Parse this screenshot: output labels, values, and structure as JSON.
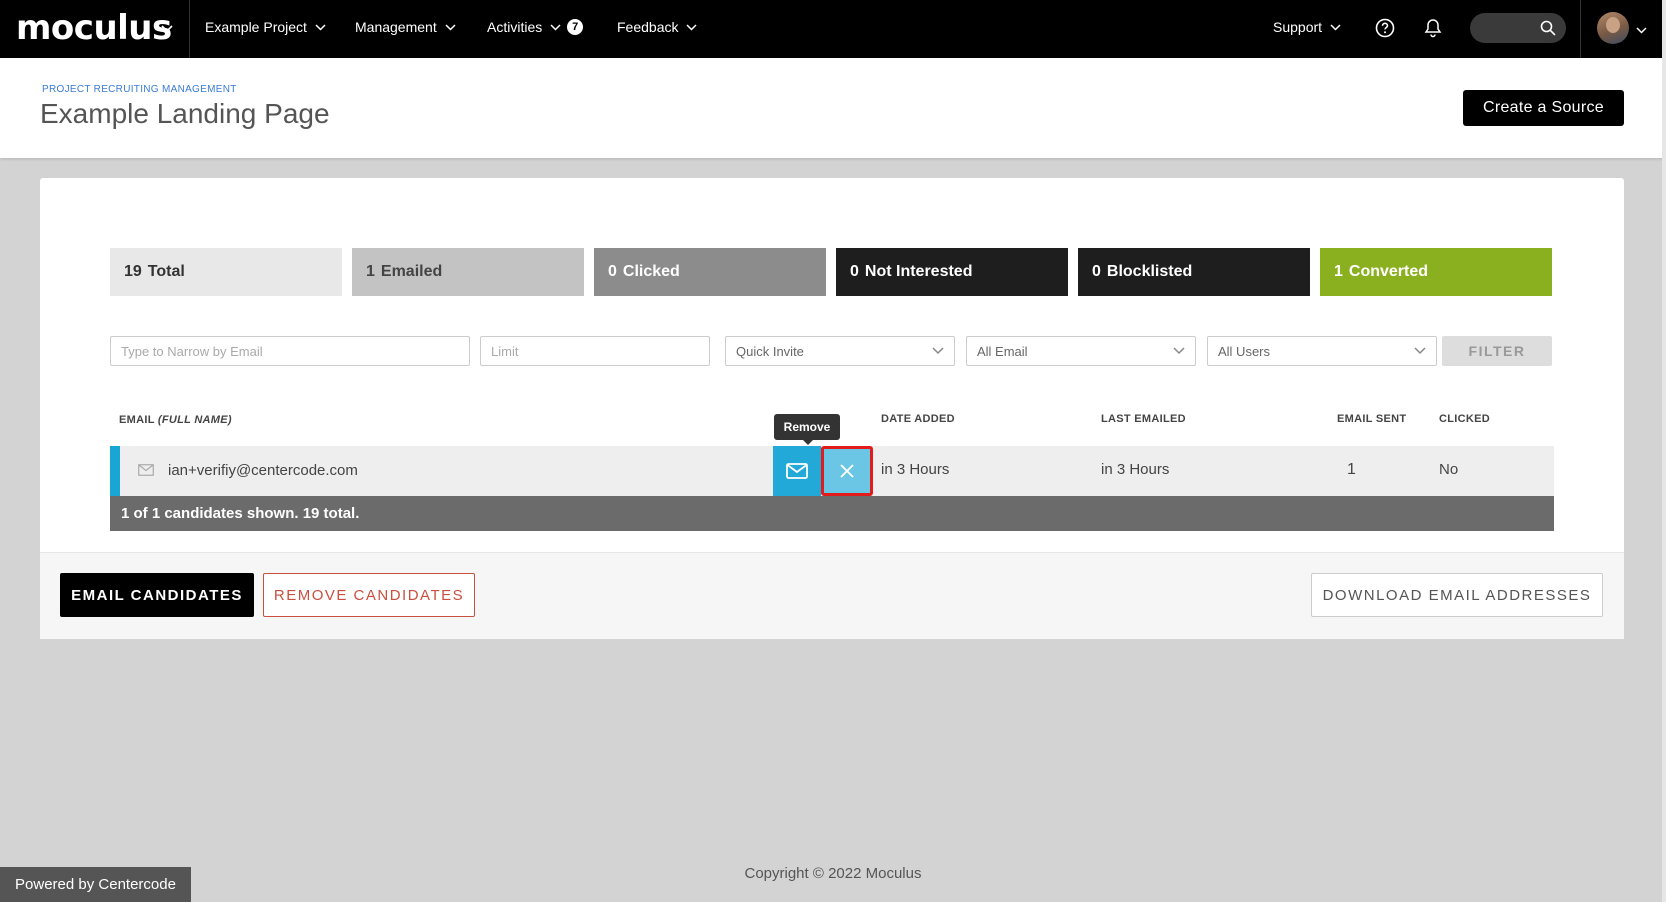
{
  "nav": {
    "logo": "moculus",
    "items": [
      {
        "label": "Example Project"
      },
      {
        "label": "Management"
      },
      {
        "label": "Activities",
        "badge": "7"
      },
      {
        "label": "Feedback"
      }
    ],
    "support_label": "Support"
  },
  "header": {
    "breadcrumb": "PROJECT RECRUITING MANAGEMENT",
    "title": "Example Landing Page",
    "create_button": "Create a Source"
  },
  "stats": [
    {
      "count": "19",
      "label": "Total",
      "bg": "#e8e8e8",
      "color": "#333"
    },
    {
      "count": "1",
      "label": "Emailed",
      "bg": "#c3c3c3",
      "color": "#444"
    },
    {
      "count": "0",
      "label": "Clicked",
      "bg": "#8c8c8c",
      "color": "#fff"
    },
    {
      "count": "0",
      "label": "Not Interested",
      "bg": "#1e1e1e",
      "color": "#fff"
    },
    {
      "count": "0",
      "label": "Blocklisted",
      "bg": "#1e1e1e",
      "color": "#fff"
    },
    {
      "count": "1",
      "label": "Converted",
      "bg": "#8bb01f",
      "color": "#fff"
    }
  ],
  "filters": {
    "email_placeholder": "Type to Narrow by Email",
    "limit_placeholder": "Limit",
    "invite_select": "Quick Invite",
    "email_select": "All Email",
    "users_select": "All Users",
    "filter_button": "FILTER"
  },
  "table": {
    "headers": {
      "email": "EMAIL ",
      "email_italic": "(FULL NAME)",
      "date_added": "DATE ADDED",
      "last_emailed": "LAST EMAILED",
      "email_sent": "EMAIL SENT",
      "clicked": "CLICKED"
    },
    "rows": [
      {
        "email": "ian+verifiy@centercode.com",
        "date_added": "in 3 Hours",
        "last_emailed": "in 3 Hours",
        "email_sent": "1",
        "clicked": "No"
      }
    ],
    "summary": "1 of 1 candidates shown. 19 total.",
    "tooltip": "Remove"
  },
  "actions": {
    "email_candidates": "EMAIL CANDIDATES",
    "remove_candidates": "REMOVE CANDIDATES",
    "download": "DOWNLOAD EMAIL ADDRESSES"
  },
  "footer": {
    "copyright": "Copyright © 2022 Moculus",
    "powered_by": "Powered by Centercode"
  }
}
